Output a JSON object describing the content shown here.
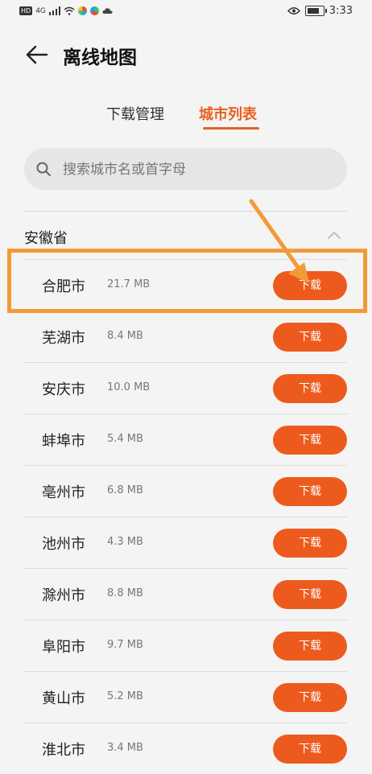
{
  "status_bar": {
    "left_badges": [
      "HD",
      "4G"
    ],
    "time": "3:33"
  },
  "header": {
    "title": "离线地图"
  },
  "tabs": [
    {
      "label": "下载管理",
      "active": false
    },
    {
      "label": "城市列表",
      "active": true
    }
  ],
  "search": {
    "placeholder": "搜索城市名或首字母"
  },
  "province": {
    "name": "安徽省"
  },
  "cities": [
    {
      "name": "合肥市",
      "size": "21.7 MB",
      "button": "下载"
    },
    {
      "name": "芜湖市",
      "size": "8.4 MB",
      "button": "下载"
    },
    {
      "name": "安庆市",
      "size": "10.0 MB",
      "button": "下载"
    },
    {
      "name": "蚌埠市",
      "size": "5.4 MB",
      "button": "下载"
    },
    {
      "name": "亳州市",
      "size": "6.8 MB",
      "button": "下载"
    },
    {
      "name": "池州市",
      "size": "4.3 MB",
      "button": "下载"
    },
    {
      "name": "滁州市",
      "size": "8.8 MB",
      "button": "下载"
    },
    {
      "name": "阜阳市",
      "size": "9.7 MB",
      "button": "下载"
    },
    {
      "name": "黄山市",
      "size": "5.2 MB",
      "button": "下载"
    },
    {
      "name": "淮北市",
      "size": "3.4 MB",
      "button": "下载"
    }
  ],
  "colors": {
    "accent": "#ec5b1d",
    "annotation": "#f39a38"
  },
  "icons": [
    "back-arrow-icon",
    "search-icon",
    "chevron-up-icon",
    "wifi-icon",
    "eye-icon",
    "battery-icon"
  ]
}
